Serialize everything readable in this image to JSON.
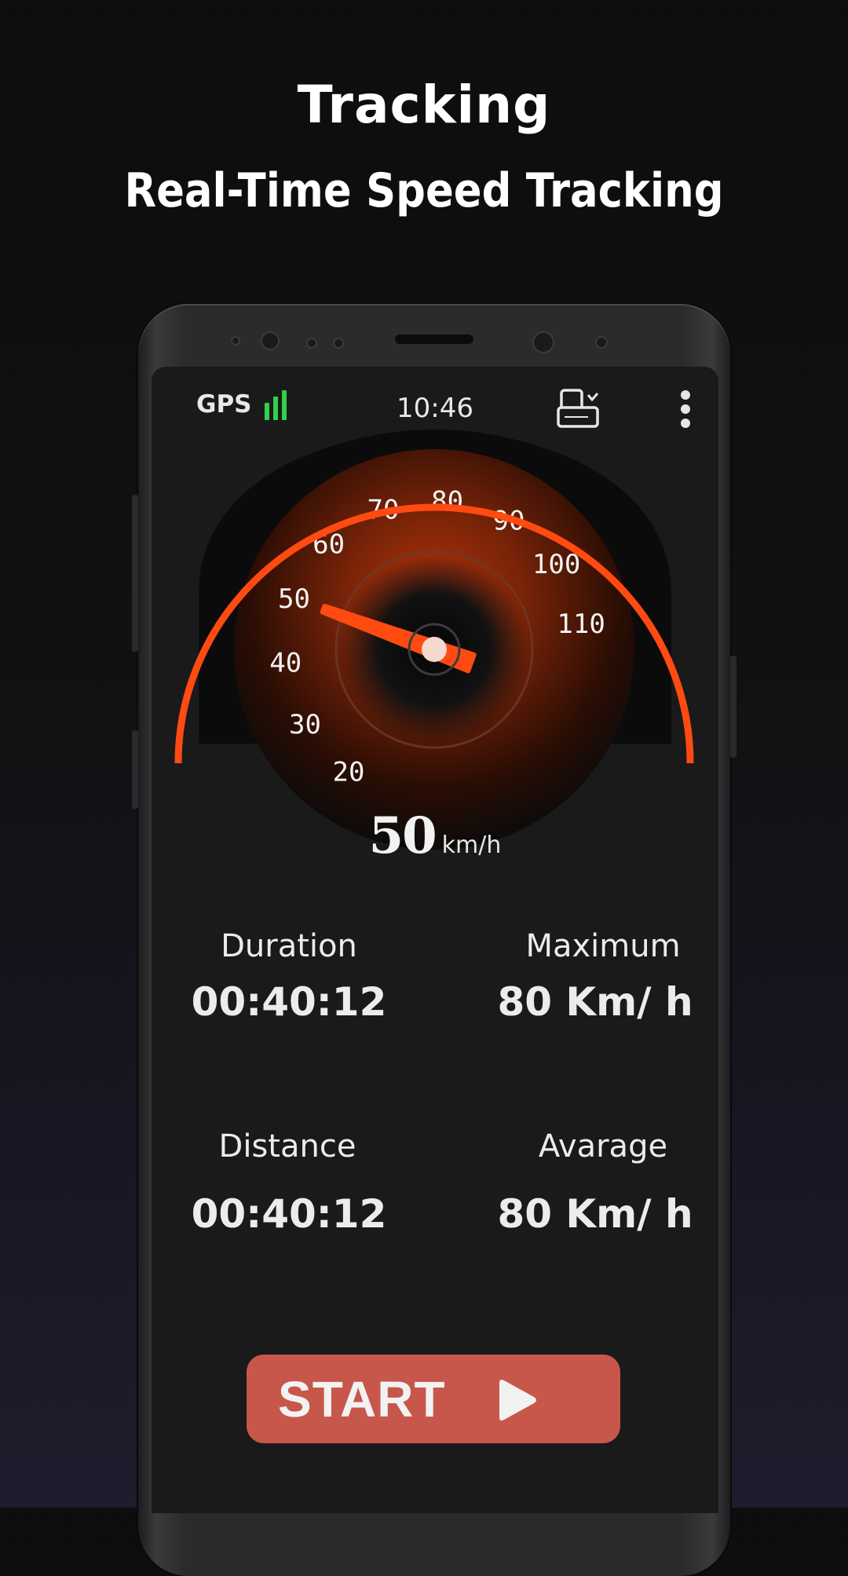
{
  "headline": {
    "title": "Tracking",
    "subtitle": "Real-Time Speed Tracking"
  },
  "status_bar": {
    "gps_label": "GPS",
    "gps_signal_color": "#35d04a",
    "time": "10:46",
    "icons": [
      "rotate-screen-icon",
      "more-vertical-icon"
    ]
  },
  "speedometer": {
    "ticks": [
      "20",
      "30",
      "40",
      "50",
      "60",
      "70",
      "80",
      "90",
      "100",
      "110"
    ],
    "needle_value": 50,
    "accent_color": "#ff4a12",
    "speed": "50",
    "unit": "km/h"
  },
  "stats": {
    "duration_label": "Duration",
    "duration_value": "00:40:12",
    "maximum_label": "Maximum",
    "maximum_value": "80 Km/ h",
    "distance_label": "Distance",
    "distance_value": "00:40:12",
    "average_label": "Avarage",
    "average_value": "80 Km/ h"
  },
  "start_button": {
    "label": "START",
    "color": "#c7574a",
    "icon": "play-icon"
  }
}
